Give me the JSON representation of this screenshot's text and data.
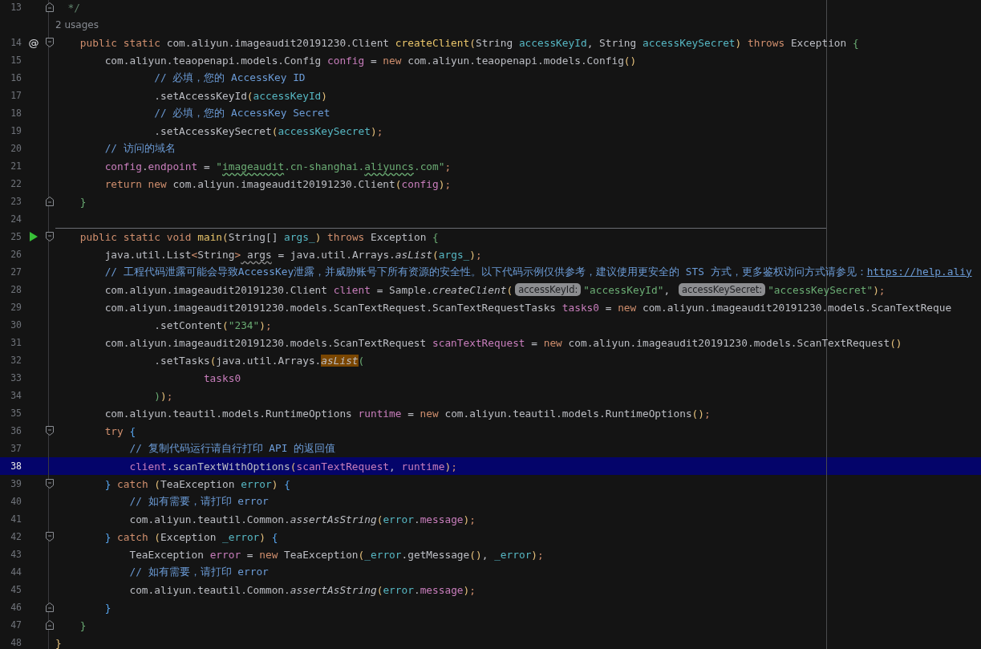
{
  "editor": {
    "lines": [
      {
        "number": "13",
        "fold": {
          "kind": "end"
        },
        "tokens": [
          {
            "kind": "doc",
            "text": "  */"
          }
        ]
      },
      {
        "kind": "usages",
        "text": "2 usages"
      },
      {
        "number": "14",
        "gutter_text": "@",
        "fold": {
          "kind": "start"
        },
        "tokens": [
          {
            "kind": "kw",
            "text": "    public static "
          },
          {
            "kind": "txt",
            "text": "com.aliyun.imageaudit20191230.Client "
          },
          {
            "kind": "fn",
            "text": "createClient"
          },
          {
            "kind": "p1",
            "text": "("
          },
          {
            "kind": "txt",
            "text": "String "
          },
          {
            "kind": "par",
            "text": "accessKeyId"
          },
          {
            "kind": "txt",
            "text": ", String "
          },
          {
            "kind": "par",
            "text": "accessKeySecret"
          },
          {
            "kind": "p1",
            "text": ")"
          },
          {
            "kind": "kw",
            "text": " throws "
          },
          {
            "kind": "txt",
            "text": "Exception "
          },
          {
            "kind": "p2",
            "text": "{"
          }
        ]
      },
      {
        "number": "15",
        "tokens": [
          {
            "kind": "txt",
            "text": "        com.aliyun.teaopenapi.models.Config "
          },
          {
            "kind": "var",
            "text": "config"
          },
          {
            "kind": "txt",
            "text": " = "
          },
          {
            "kind": "kw",
            "text": "new"
          },
          {
            "kind": "txt",
            "text": " com.aliyun.teaopenapi.models.Config"
          },
          {
            "kind": "p1",
            "text": "()"
          }
        ]
      },
      {
        "number": "16",
        "tokens": [
          {
            "kind": "cmt",
            "text": "                // 必填，您的 AccessKey ID"
          }
        ]
      },
      {
        "number": "17",
        "tokens": [
          {
            "kind": "txt",
            "text": "                .setAccessKeyId"
          },
          {
            "kind": "p1",
            "text": "("
          },
          {
            "kind": "par",
            "text": "accessKeyId"
          },
          {
            "kind": "p1",
            "text": ")"
          }
        ]
      },
      {
        "number": "18",
        "tokens": [
          {
            "kind": "cmt",
            "text": "                // 必填，您的 AccessKey Secret"
          }
        ]
      },
      {
        "number": "19",
        "tokens": [
          {
            "kind": "txt",
            "text": "                .setAccessKeySecret"
          },
          {
            "kind": "p1",
            "text": "("
          },
          {
            "kind": "par",
            "text": "accessKeySecret"
          },
          {
            "kind": "p1",
            "text": ")"
          },
          {
            "kind": "semi",
            "text": ";"
          }
        ]
      },
      {
        "number": "20",
        "tokens": [
          {
            "kind": "cmt",
            "text": "        // 访问的域名"
          }
        ]
      },
      {
        "number": "21",
        "tokens": [
          {
            "kind": "var",
            "text": "        config"
          },
          {
            "kind": "txt",
            "text": "."
          },
          {
            "kind": "var",
            "text": "endpoint"
          },
          {
            "kind": "txt",
            "text": " = "
          },
          {
            "kind": "str",
            "text": "\""
          },
          {
            "kind": "typo",
            "text": "imageaudit"
          },
          {
            "kind": "str",
            "text": ".cn-shanghai."
          },
          {
            "kind": "typo",
            "text": "aliyuncs"
          },
          {
            "kind": "str",
            "text": ".com\""
          },
          {
            "kind": "semi",
            "text": ";"
          }
        ]
      },
      {
        "number": "22",
        "tokens": [
          {
            "kind": "kw",
            "text": "        return new"
          },
          {
            "kind": "txt",
            "text": " com.aliyun.imageaudit20191230.Client"
          },
          {
            "kind": "p1",
            "text": "("
          },
          {
            "kind": "var",
            "text": "config"
          },
          {
            "kind": "p1",
            "text": ")"
          },
          {
            "kind": "semi",
            "text": ";"
          }
        ]
      },
      {
        "number": "23",
        "fold": {
          "kind": "end"
        },
        "tokens": [
          {
            "kind": "p2",
            "text": "    }"
          }
        ]
      },
      {
        "number": "24"
      },
      {
        "number": "25",
        "gutter_icon": {
          "kind": "run"
        },
        "fold": {
          "kind": "start"
        },
        "separator": true,
        "tokens": [
          {
            "kind": "kw",
            "text": "    public static void "
          },
          {
            "kind": "fn",
            "text": "main"
          },
          {
            "kind": "p1",
            "text": "("
          },
          {
            "kind": "txt",
            "text": "String[] "
          },
          {
            "kind": "par",
            "text": "args_"
          },
          {
            "kind": "p1",
            "text": ")"
          },
          {
            "kind": "kw",
            "text": " throws "
          },
          {
            "kind": "txt",
            "text": "Exception "
          },
          {
            "kind": "p2",
            "text": "{"
          }
        ]
      },
      {
        "number": "26",
        "tokens": [
          {
            "kind": "txt",
            "text": "        java.util.List"
          },
          {
            "kind": "kw",
            "text": "<"
          },
          {
            "kind": "txt",
            "text": "String"
          },
          {
            "kind": "kw",
            "text": ">"
          },
          {
            "kind": "warn",
            "text": " args"
          },
          {
            "kind": "txt",
            "text": " = java.util.Arrays."
          },
          {
            "kind": "it",
            "text": "asList"
          },
          {
            "kind": "p1",
            "text": "("
          },
          {
            "kind": "par",
            "text": "args_"
          },
          {
            "kind": "p1",
            "text": ")"
          },
          {
            "kind": "semi",
            "text": ";"
          }
        ]
      },
      {
        "number": "27",
        "tokens": [
          {
            "kind": "cmt",
            "text": "        // 工程代码泄露可能会导致AccessKey泄露，并威胁账号下所有资源的安全性。以下代码示例仅供参考，建议使用更安全的 STS 方式，更多鉴权访问方式请参见："
          },
          {
            "kind": "link",
            "text": "https://help.aliy"
          }
        ]
      },
      {
        "number": "28",
        "tokens": [
          {
            "kind": "txt",
            "text": "        com.aliyun.imageaudit20191230.Client "
          },
          {
            "kind": "var",
            "text": "client"
          },
          {
            "kind": "txt",
            "text": " = Sample."
          },
          {
            "kind": "it",
            "text": "createClient"
          },
          {
            "kind": "p1",
            "text": "("
          },
          {
            "kind": "hint",
            "text": "accessKeyId:"
          },
          {
            "kind": "str",
            "text": "\"accessKeyId\""
          },
          {
            "kind": "txt",
            "text": ", "
          },
          {
            "kind": "hint",
            "text": "accessKeySecret:"
          },
          {
            "kind": "str",
            "text": "\"accessKeySecret\""
          },
          {
            "kind": "p1",
            "text": ")"
          },
          {
            "kind": "semi",
            "text": ";"
          }
        ]
      },
      {
        "number": "29",
        "tokens": [
          {
            "kind": "txt",
            "text": "        com.aliyun.imageaudit20191230.models.ScanTextRequest.ScanTextRequestTasks "
          },
          {
            "kind": "var",
            "text": "tasks0"
          },
          {
            "kind": "txt",
            "text": " = "
          },
          {
            "kind": "kw",
            "text": "new"
          },
          {
            "kind": "txt",
            "text": " com.aliyun.imageaudit20191230.models.ScanTextReque"
          }
        ]
      },
      {
        "number": "30",
        "tokens": [
          {
            "kind": "txt",
            "text": "                .setContent"
          },
          {
            "kind": "p1",
            "text": "("
          },
          {
            "kind": "str",
            "text": "\"234\""
          },
          {
            "kind": "p1",
            "text": ")"
          },
          {
            "kind": "semi",
            "text": ";"
          }
        ]
      },
      {
        "number": "31",
        "tokens": [
          {
            "kind": "txt",
            "text": "        com.aliyun.imageaudit20191230.models.ScanTextRequest "
          },
          {
            "kind": "var",
            "text": "scanTextRequest"
          },
          {
            "kind": "txt",
            "text": " = "
          },
          {
            "kind": "kw",
            "text": "new"
          },
          {
            "kind": "txt",
            "text": " com.aliyun.imageaudit20191230.models.ScanTextRequest"
          },
          {
            "kind": "p1",
            "text": "()"
          }
        ]
      },
      {
        "number": "32",
        "tokens": [
          {
            "kind": "txt",
            "text": "                .setTasks"
          },
          {
            "kind": "p1",
            "text": "("
          },
          {
            "kind": "txt",
            "text": "java.util.Arrays."
          },
          {
            "kind": "hl",
            "text": "asList"
          },
          {
            "kind": "p2",
            "text": "("
          }
        ]
      },
      {
        "number": "33",
        "tokens": [
          {
            "kind": "var",
            "text": "                        tasks0"
          }
        ]
      },
      {
        "number": "34",
        "tokens": [
          {
            "kind": "p2",
            "text": "                )"
          },
          {
            "kind": "p1",
            "text": ")"
          },
          {
            "kind": "semi",
            "text": ";"
          }
        ]
      },
      {
        "number": "35",
        "tokens": [
          {
            "kind": "txt",
            "text": "        com.aliyun.teautil.models.RuntimeOptions "
          },
          {
            "kind": "var",
            "text": "runtime"
          },
          {
            "kind": "txt",
            "text": " = "
          },
          {
            "kind": "kw",
            "text": "new"
          },
          {
            "kind": "txt",
            "text": " com.aliyun.teautil.models.RuntimeOptions"
          },
          {
            "kind": "p1",
            "text": "()"
          },
          {
            "kind": "semi",
            "text": ";"
          }
        ]
      },
      {
        "number": "36",
        "fold": {
          "kind": "start"
        },
        "tokens": [
          {
            "kind": "kw",
            "text": "        try "
          },
          {
            "kind": "p3",
            "text": "{"
          }
        ]
      },
      {
        "number": "37",
        "tokens": [
          {
            "kind": "cmt",
            "text": "            // 复制代码运行请自行打印 API 的返回值"
          }
        ]
      },
      {
        "number": "38",
        "current": true,
        "tokens": [
          {
            "kind": "var",
            "text": "            client"
          },
          {
            "kind": "txt",
            "text": ".scanTextWithOptions"
          },
          {
            "kind": "p1",
            "text": "("
          },
          {
            "kind": "var",
            "text": "scanTextRequest"
          },
          {
            "kind": "txt",
            "text": ", "
          },
          {
            "kind": "var",
            "text": "runtime"
          },
          {
            "kind": "p1",
            "text": ")"
          },
          {
            "kind": "semi",
            "text": ";"
          }
        ]
      },
      {
        "number": "39",
        "fold": {
          "kind": "start"
        },
        "tokens": [
          {
            "kind": "p3",
            "text": "        }"
          },
          {
            "kind": "kw",
            "text": " catch "
          },
          {
            "kind": "p1",
            "text": "("
          },
          {
            "kind": "txt",
            "text": "TeaException "
          },
          {
            "kind": "par",
            "text": "error"
          },
          {
            "kind": "p1",
            "text": ")"
          },
          {
            "kind": "p3",
            "text": " {"
          }
        ]
      },
      {
        "number": "40",
        "tokens": [
          {
            "kind": "cmt",
            "text": "            // 如有需要，请打印 error"
          }
        ]
      },
      {
        "number": "41",
        "tokens": [
          {
            "kind": "txt",
            "text": "            com.aliyun.teautil.Common."
          },
          {
            "kind": "it",
            "text": "assertAsString"
          },
          {
            "kind": "p1",
            "text": "("
          },
          {
            "kind": "par",
            "text": "error"
          },
          {
            "kind": "txt",
            "text": "."
          },
          {
            "kind": "var",
            "text": "message"
          },
          {
            "kind": "p1",
            "text": ")"
          },
          {
            "kind": "semi",
            "text": ";"
          }
        ]
      },
      {
        "number": "42",
        "fold": {
          "kind": "start"
        },
        "tokens": [
          {
            "kind": "p3",
            "text": "        }"
          },
          {
            "kind": "kw",
            "text": " catch "
          },
          {
            "kind": "p1",
            "text": "("
          },
          {
            "kind": "txt",
            "text": "Exception "
          },
          {
            "kind": "par",
            "text": "_error"
          },
          {
            "kind": "p1",
            "text": ")"
          },
          {
            "kind": "p3",
            "text": " {"
          }
        ]
      },
      {
        "number": "43",
        "tokens": [
          {
            "kind": "txt",
            "text": "            TeaException "
          },
          {
            "kind": "var",
            "text": "error"
          },
          {
            "kind": "txt",
            "text": " = "
          },
          {
            "kind": "kw",
            "text": "new"
          },
          {
            "kind": "txt",
            "text": " TeaException"
          },
          {
            "kind": "p1",
            "text": "("
          },
          {
            "kind": "par",
            "text": "_error"
          },
          {
            "kind": "txt",
            "text": ".getMessage"
          },
          {
            "kind": "p1",
            "text": "()"
          },
          {
            "kind": "txt",
            "text": ", "
          },
          {
            "kind": "par",
            "text": "_error"
          },
          {
            "kind": "p1",
            "text": ")"
          },
          {
            "kind": "semi",
            "text": ";"
          }
        ]
      },
      {
        "number": "44",
        "tokens": [
          {
            "kind": "cmt",
            "text": "            // 如有需要，请打印 error"
          }
        ]
      },
      {
        "number": "45",
        "tokens": [
          {
            "kind": "txt",
            "text": "            com.aliyun.teautil.Common."
          },
          {
            "kind": "it",
            "text": "assertAsString"
          },
          {
            "kind": "p1",
            "text": "("
          },
          {
            "kind": "par",
            "text": "error"
          },
          {
            "kind": "txt",
            "text": "."
          },
          {
            "kind": "var",
            "text": "message"
          },
          {
            "kind": "p1",
            "text": ")"
          },
          {
            "kind": "semi",
            "text": ";"
          }
        ]
      },
      {
        "number": "46",
        "fold": {
          "kind": "end"
        },
        "tokens": [
          {
            "kind": "p3",
            "text": "        }"
          }
        ]
      },
      {
        "number": "47",
        "fold": {
          "kind": "end"
        },
        "tokens": [
          {
            "kind": "p2",
            "text": "    }"
          }
        ]
      },
      {
        "number": "48",
        "tokens": [
          {
            "kind": "p1",
            "text": "}"
          }
        ]
      }
    ]
  }
}
